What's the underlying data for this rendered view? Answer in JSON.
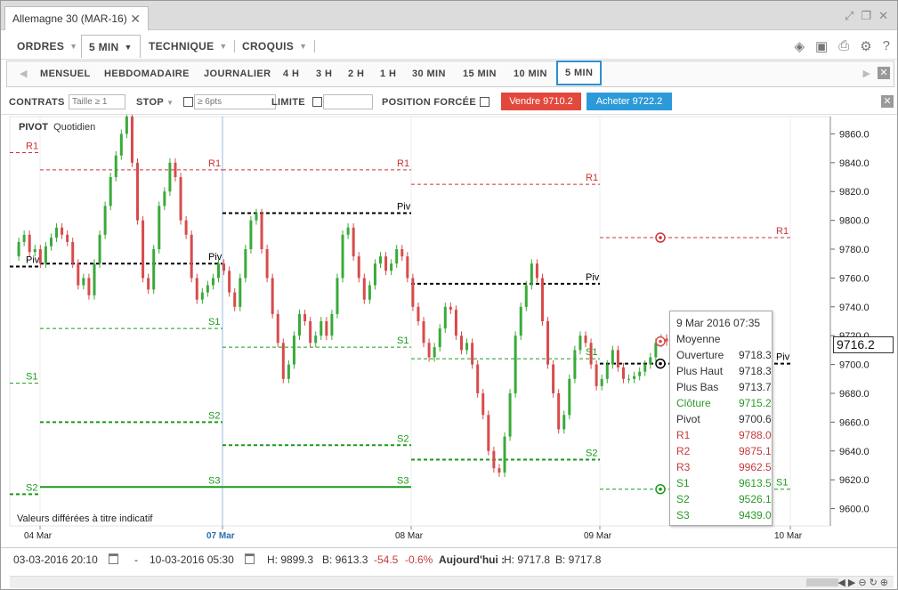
{
  "window": {
    "title": "Allemagne 30 (MAR-16)",
    "close": "✕"
  },
  "menu": {
    "ordres": "ORDRES",
    "interval": "5 MIN",
    "technique": "TECHNIQUE",
    "croquis": "CROQUIS"
  },
  "periods": [
    "MENSUEL",
    "HEBDOMADAIRE",
    "JOURNALIER",
    "4 H",
    "3 H",
    "2 H",
    "1 H",
    "30 MIN",
    "15 MIN",
    "10 MIN",
    "5 MIN"
  ],
  "order_bar": {
    "contrats": "CONTRATS",
    "taille_placeholder": "Taille ≥ 1",
    "stop": "STOP",
    "stop_placeholder": "≥ 6pts",
    "limite": "LIMITE",
    "position_forcee": "POSITION FORCÉE",
    "sell": "Vendre 9710.2",
    "buy": "Acheter 9722.2"
  },
  "chart": {
    "indicator": "PIVOT",
    "indicator_period": "Quotidien",
    "disclaimer": "Valeurs différées à titre indicatif",
    "current_price": "9716.2",
    "level_labels": {
      "r1": "R1",
      "piv": "Piv",
      "s1": "S1",
      "s2": "S2",
      "s3": "S3"
    },
    "colors": {
      "up": "#3aaa3a",
      "down": "#d84b4b",
      "red_level": "#cc3333",
      "green_level": "#1a9a1a",
      "pivot": "#000000"
    }
  },
  "chart_data": {
    "type": "candlestick",
    "y_ticks": [
      9600.0,
      9620.0,
      9640.0,
      9660.0,
      9680.0,
      9700.0,
      9720.0,
      9740.0,
      9760.0,
      9780.0,
      9800.0,
      9820.0,
      9840.0,
      9860.0
    ],
    "y_tick_labels": [
      "9600.0",
      "9620.0",
      "9640.0",
      "9660.0",
      "9680.0",
      "9700.0",
      "9720.0",
      "9740.0",
      "9760.0",
      "9780.0",
      "9800.0",
      "9820.0",
      "9840.0",
      "9860.0"
    ],
    "ylim": [
      9588,
      9872
    ],
    "x_labels": [
      "04 Mar",
      "07 Mar",
      "08 Mar",
      "09 Mar",
      "10 Mar"
    ],
    "x_label_highlight": "07 Mar",
    "pivot_levels": [
      {
        "day": "04 Mar",
        "r1": 9835,
        "piv": 9770,
        "s1": 9725,
        "s2": 9660,
        "s3": 9615
      },
      {
        "day": "07 Mar",
        "r1": 9835,
        "piv": 9805,
        "s1": 9712,
        "s2": 9644,
        "s3": 9615
      },
      {
        "day": "08 Mar",
        "r1": 9825,
        "piv": 9756,
        "s1": 9704,
        "s2": 9634,
        "s3": 9588
      },
      {
        "day": "09 Mar",
        "r1": 9788,
        "piv": 9700.6,
        "s1": 9613.5,
        "s2": 9526.1,
        "s3": 9439
      }
    ],
    "prev_day": {
      "r1": 9847,
      "piv": 9768,
      "s1": 9687,
      "s2": 9610
    },
    "price_path": [
      9775,
      9785,
      9790,
      9778,
      9780,
      9770,
      9782,
      9788,
      9795,
      9790,
      9785,
      9770,
      9755,
      9760,
      9748,
      9770,
      9790,
      9810,
      9830,
      9845,
      9860,
      9872,
      9840,
      9800,
      9760,
      9752,
      9780,
      9810,
      9820,
      9840,
      9830,
      9800,
      9790,
      9760,
      9745,
      9750,
      9755,
      9760,
      9770,
      9765,
      9750,
      9740,
      9760,
      9780,
      9800,
      9805,
      9780,
      9760,
      9735,
      9715,
      9690,
      9700,
      9720,
      9735,
      9730,
      9715,
      9720,
      9730,
      9720,
      9735,
      9760,
      9790,
      9795,
      9775,
      9760,
      9745,
      9755,
      9770,
      9775,
      9765,
      9770,
      9780,
      9775,
      9760,
      9740,
      9730,
      9715,
      9705,
      9712,
      9725,
      9740,
      9738,
      9720,
      9710,
      9715,
      9700,
      9680,
      9665,
      9640,
      9628,
      9625,
      9650,
      9680,
      9720,
      9740,
      9755,
      9770,
      9760,
      9730,
      9700,
      9680,
      9655,
      9665,
      9690,
      9710,
      9720,
      9715,
      9700,
      9685,
      9690,
      9700,
      9710,
      9698,
      9690,
      9690,
      9692,
      9695,
      9700,
      9705,
      9715,
      9718,
      9716
    ]
  },
  "tooltip": {
    "date": "9 Mar 2016 07:35",
    "moyenne": "Moyenne",
    "rows": [
      {
        "label": "Ouverture",
        "value": "9718.3",
        "cls": ""
      },
      {
        "label": "Plus Haut",
        "value": "9718.3",
        "cls": ""
      },
      {
        "label": "Plus Bas",
        "value": "9713.7",
        "cls": ""
      },
      {
        "label": "Clôture",
        "value": "9715.2",
        "cls": "green"
      },
      {
        "label": "Pivot",
        "value": "9700.6",
        "cls": ""
      },
      {
        "label": "R1",
        "value": "9788.0",
        "cls": "red"
      },
      {
        "label": "R2",
        "value": "9875.1",
        "cls": "red"
      },
      {
        "label": "R3",
        "value": "9962.5",
        "cls": "red"
      },
      {
        "label": "S1",
        "value": "9613.5",
        "cls": "green"
      },
      {
        "label": "S2",
        "value": "9526.1",
        "cls": "green"
      },
      {
        "label": "S3",
        "value": "9439.0",
        "cls": "green"
      }
    ]
  },
  "status": {
    "from": "03-03-2016 20:10",
    "dash": "-",
    "to": "10-03-2016 05:30",
    "high": "H: 9899.3",
    "low": "B: 9613.3",
    "change": "-54.5",
    "change_pct": "-0.6%",
    "today_label": "Aujourd'hui :",
    "today_high": "H: 9717.8",
    "today_low": "B: 9717.8"
  }
}
